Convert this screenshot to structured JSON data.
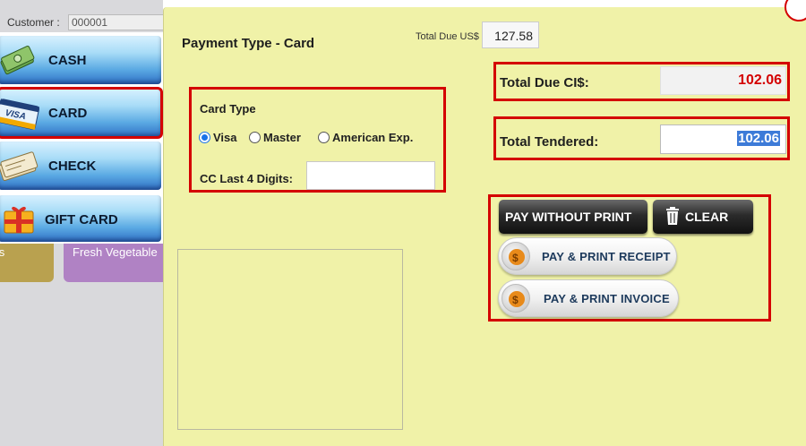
{
  "customer": {
    "label": "Customer :",
    "id": "000001"
  },
  "categories": [
    {
      "label": "erbs"
    },
    {
      "label": "Fresh Vegetable"
    }
  ],
  "payment_menu": [
    {
      "label": "CASH",
      "icon": "cash-icon"
    },
    {
      "label": "CARD",
      "icon": "visa-card-icon",
      "selected": true
    },
    {
      "label": "CHECK",
      "icon": "check-icon"
    },
    {
      "label": "GIFT CARD",
      "icon": "gift-card-icon"
    }
  ],
  "panel": {
    "title": "Payment Type - Card",
    "usd_label": "Total Due US$",
    "usd_value": "127.58",
    "card_type": {
      "title": "Card Type",
      "options": [
        {
          "label": "Visa",
          "selected": true
        },
        {
          "label": "Master",
          "selected": false
        },
        {
          "label": "American Exp.",
          "selected": false
        }
      ],
      "cc_label": "CC Last 4 Digits:",
      "cc_value": ""
    },
    "total_due_label": "Total Due CI$:",
    "total_due_value": "102.06",
    "total_tendered_label": "Total Tendered:",
    "total_tendered_value": "102.06",
    "buttons": {
      "pay_without_print": "PAY WITHOUT PRINT",
      "clear": "CLEAR",
      "pay_print_receipt": "PAY & PRINT RECEIPT",
      "pay_print_invoice": "PAY & PRINT INVOICE"
    }
  },
  "colors": {
    "panel_bg": "#f0f2a8",
    "highlight_border": "#d40000",
    "due_value": "#d40000",
    "menu_button": "#5aa9e3"
  }
}
